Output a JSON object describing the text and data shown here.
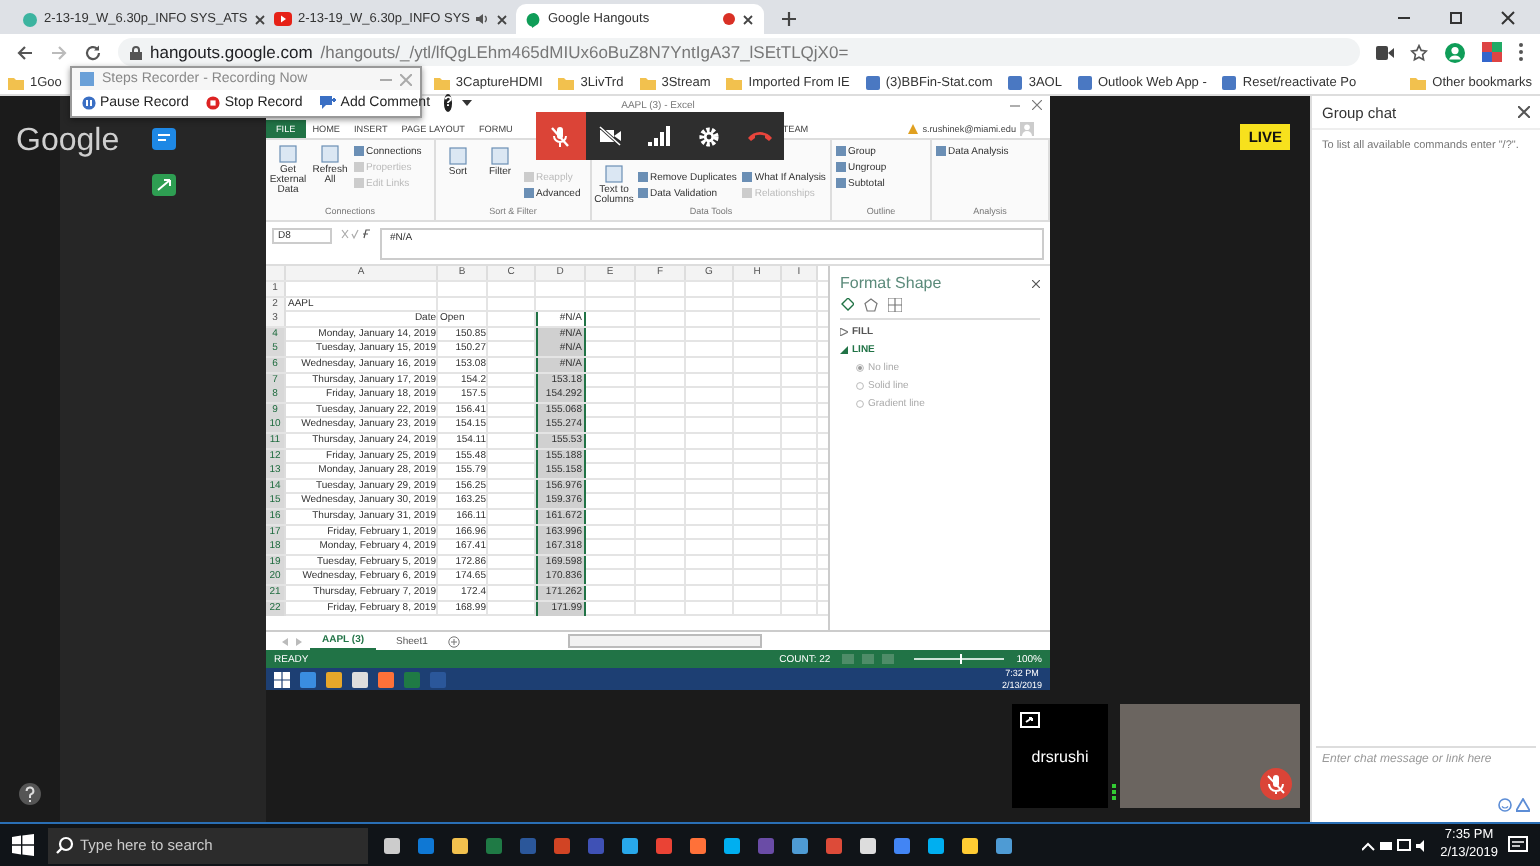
{
  "browser": {
    "tabs": [
      {
        "title": "2-13-19_W_6.30p_INFO SYS_ATS",
        "kind": "circle",
        "selected": false,
        "audio": false,
        "recording": false
      },
      {
        "title": "2-13-19_W_6.30p_INFO SYS",
        "kind": "video",
        "selected": false,
        "audio": true,
        "recording": false
      },
      {
        "title": "Google Hangouts",
        "kind": "chat",
        "selected": true,
        "audio": false,
        "recording": true
      }
    ],
    "url": {
      "host": "hangouts.google.com",
      "path": "/hangouts/_/ytl/lfQgLEhm465dMIUx6oBuZ8N7YntIgA37_lSEtTLQjX0="
    },
    "bookmarks": [
      {
        "label": "1Goo",
        "kind": "folder"
      },
      {
        "label": "3CaptureHDMI",
        "kind": "folder"
      },
      {
        "label": "3LivTrd",
        "kind": "folder"
      },
      {
        "label": "3Stream",
        "kind": "folder"
      },
      {
        "label": "Imported From IE",
        "kind": "folder"
      },
      {
        "label": "(3)BBFin-Stat.com",
        "kind": "page"
      },
      {
        "label": "3AOL",
        "kind": "page"
      },
      {
        "label": "Outlook Web App -",
        "kind": "page"
      },
      {
        "label": "Reset/reactivate Po",
        "kind": "page"
      }
    ],
    "other_bookmarks": "Other bookmarks"
  },
  "steps_recorder": {
    "title": "Steps Recorder - Recording Now",
    "buttons": [
      {
        "label": "Pause Record",
        "kind": "pause"
      },
      {
        "label": "Stop Record",
        "kind": "stop"
      },
      {
        "label": "Add Comment",
        "kind": "comment"
      }
    ],
    "help": "?"
  },
  "hangouts": {
    "logo": "Google",
    "live": "LIVE",
    "controls": [
      {
        "kind": "mic",
        "muted": true
      },
      {
        "kind": "camera",
        "muted": true
      },
      {
        "kind": "signal"
      },
      {
        "kind": "settings"
      },
      {
        "kind": "hangup"
      }
    ],
    "participant": {
      "name": "drsrushi",
      "muted": true
    }
  },
  "excel": {
    "title": "AAPL (3) - Excel",
    "file_tab": "FILE",
    "tabs": [
      "HOME",
      "INSERT",
      "PAGE LAYOUT",
      "FORMU",
      "TEAM"
    ],
    "user": "s.rushinek@miami.edu",
    "groups": [
      {
        "label": "Connections",
        "buttons": [
          {
            "label": "Get External Data",
            "kind": "large",
            "disabled": false
          },
          {
            "label": "Refresh All",
            "kind": "large",
            "disabled": false
          },
          {
            "label": "Connections",
            "kind": "small",
            "disabled": false
          },
          {
            "label": "Properties",
            "kind": "small",
            "disabled": true
          },
          {
            "label": "Edit Links",
            "kind": "small",
            "disabled": true
          }
        ]
      },
      {
        "label": "Sort & Filter",
        "buttons": [
          {
            "label": "Sort",
            "kind": "large",
            "disabled": false
          },
          {
            "label": "Filter",
            "kind": "large",
            "disabled": false
          },
          {
            "label": "Reapply",
            "kind": "small",
            "disabled": true
          },
          {
            "label": "Advanced",
            "kind": "small",
            "disabled": false
          }
        ]
      },
      {
        "label": "Data Tools",
        "buttons": [
          {
            "label": "Text to Columns",
            "kind": "large",
            "disabled": false
          },
          {
            "label": "Remove Duplicates",
            "kind": "small",
            "disabled": false
          },
          {
            "label": "Data Validation",
            "kind": "small",
            "disabled": false
          },
          {
            "label": "What If Analysis",
            "kind": "small",
            "disabled": false
          },
          {
            "label": "Relationships",
            "kind": "small",
            "disabled": true
          }
        ]
      },
      {
        "label": "Outline",
        "buttons": [
          {
            "label": "Group",
            "kind": "small",
            "disabled": false
          },
          {
            "label": "Ungroup",
            "kind": "small",
            "disabled": false
          },
          {
            "label": "Subtotal",
            "kind": "small",
            "disabled": false
          }
        ]
      },
      {
        "label": "Analysis",
        "buttons": [
          {
            "label": "Data Analysis",
            "kind": "small",
            "disabled": false
          }
        ]
      }
    ],
    "name_box": "D8",
    "formula": "#N/A",
    "columns": [
      "A",
      "B",
      "C",
      "D",
      "E",
      "F",
      "G",
      "H",
      "I"
    ],
    "rows": [
      {
        "num": "1",
        "selected": false
      },
      {
        "num": "2",
        "a": "AAPL",
        "selected": false
      },
      {
        "num": "3",
        "a": "Date",
        "b": "Open",
        "d": "#N/A",
        "selected": false
      },
      {
        "num": "4",
        "a": "Monday, January 14, 2019",
        "b": "150.85",
        "d": "#N/A",
        "selected": true
      },
      {
        "num": "5",
        "a": "Tuesday, January 15, 2019",
        "b": "150.27",
        "d": "#N/A",
        "selected": true
      },
      {
        "num": "6",
        "a": "Wednesday, January 16, 2019",
        "b": "153.08",
        "d": "#N/A",
        "selected": true
      },
      {
        "num": "7",
        "a": "Thursday, January 17, 2019",
        "b": "154.2",
        "d": "153.18",
        "selected": true
      },
      {
        "num": "8",
        "a": "Friday, January 18, 2019",
        "b": "157.5",
        "d": "154.292",
        "selected": true
      },
      {
        "num": "9",
        "a": "Tuesday, January 22, 2019",
        "b": "156.41",
        "d": "155.068",
        "selected": true
      },
      {
        "num": "10",
        "a": "Wednesday, January 23, 2019",
        "b": "154.15",
        "d": "155.274",
        "selected": true
      },
      {
        "num": "11",
        "a": "Thursday, January 24, 2019",
        "b": "154.11",
        "d": "155.53",
        "selected": true
      },
      {
        "num": "12",
        "a": "Friday, January 25, 2019",
        "b": "155.48",
        "d": "155.188",
        "selected": true
      },
      {
        "num": "13",
        "a": "Monday, January 28, 2019",
        "b": "155.79",
        "d": "155.158",
        "selected": true
      },
      {
        "num": "14",
        "a": "Tuesday, January 29, 2019",
        "b": "156.25",
        "d": "156.976",
        "selected": true
      },
      {
        "num": "15",
        "a": "Wednesday, January 30, 2019",
        "b": "163.25",
        "d": "159.376",
        "selected": true
      },
      {
        "num": "16",
        "a": "Thursday, January 31, 2019",
        "b": "166.11",
        "d": "161.672",
        "selected": true
      },
      {
        "num": "17",
        "a": "Friday, February 1, 2019",
        "b": "166.96",
        "d": "163.996",
        "selected": true
      },
      {
        "num": "18",
        "a": "Monday, February 4, 2019",
        "b": "167.41",
        "d": "167.318",
        "selected": true
      },
      {
        "num": "19",
        "a": "Tuesday, February 5, 2019",
        "b": "172.86",
        "d": "169.598",
        "selected": true
      },
      {
        "num": "20",
        "a": "Wednesday, February 6, 2019",
        "b": "174.65",
        "d": "170.836",
        "selected": true
      },
      {
        "num": "21",
        "a": "Thursday, February 7, 2019",
        "b": "172.4",
        "d": "171.262",
        "selected": true
      },
      {
        "num": "22",
        "a": "Friday, February 8, 2019",
        "b": "168.99",
        "d": "171.99",
        "selected": true
      }
    ],
    "pane": {
      "title": "Format Shape",
      "sections": [
        {
          "label": "FILL",
          "expanded": false
        },
        {
          "label": "LINE",
          "expanded": true
        }
      ],
      "options": [
        {
          "label": "No line",
          "selected": true
        },
        {
          "label": "Solid line",
          "selected": false
        },
        {
          "label": "Gradient line",
          "selected": false
        }
      ]
    },
    "sheets": [
      {
        "label": "AAPL (3)",
        "selected": true
      },
      {
        "label": "Sheet1",
        "selected": false
      }
    ],
    "status": "READY",
    "count": "COUNT: 22",
    "zoom": {
      "level": 0.5,
      "reading": "100%"
    },
    "taskbar": {
      "time": "7:32 PM",
      "date": "2/13/2019"
    }
  },
  "chat": {
    "title": "Group chat",
    "hint": "To list all available commands enter \"/?\".",
    "placeholder": "Enter chat message or link here"
  },
  "taskbar": {
    "search_placeholder": "Type here to search",
    "time": "7:35 PM",
    "date": "2/13/2019"
  }
}
